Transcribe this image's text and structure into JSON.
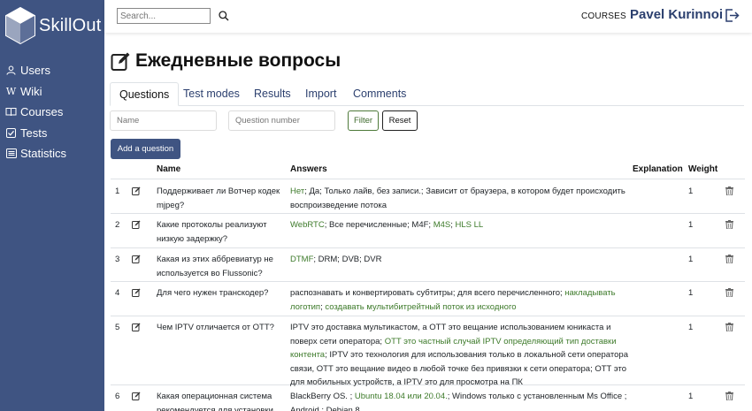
{
  "app": {
    "brand": "SkillOut"
  },
  "sidebar": {
    "items": [
      {
        "label": "Users",
        "icon": "user-icon"
      },
      {
        "label": "Wiki",
        "icon": "wiki-icon"
      },
      {
        "label": "Courses",
        "icon": "book-icon"
      },
      {
        "label": "Tests",
        "icon": "checkbox-icon"
      },
      {
        "label": "Statistics",
        "icon": "list-icon"
      }
    ]
  },
  "header": {
    "search_placeholder": "Search...",
    "courses_label": "COURSES",
    "user_name": "Pavel Kurinnoi"
  },
  "page": {
    "title": "Ежедневные вопросы"
  },
  "tabs": [
    {
      "label": "Questions",
      "active": true
    },
    {
      "label": "Test modes"
    },
    {
      "label": "Results"
    },
    {
      "label": "Import"
    },
    {
      "label": "Comments"
    }
  ],
  "filters": {
    "name_placeholder": "Name",
    "number_placeholder": "Question number",
    "filter_label": "Filter",
    "reset_label": "Reset"
  },
  "add_question_label": "Add a question",
  "table": {
    "headers": {
      "name": "Name",
      "answers": "Answers",
      "explanation": "Explanation",
      "weight": "Weight"
    },
    "rows": [
      {
        "num": "1",
        "name": "Поддерживает ли Вотчер кодек mjpeg?",
        "answers": [
          {
            "text": "Нет",
            "correct": true
          },
          {
            "text": "; Да; Только лайв, без записи.; Зависит от браузера, в котором будет происходить воспроизведение потока",
            "correct": false
          }
        ],
        "weight": "1"
      },
      {
        "num": "2",
        "name": "Какие протоколы реализуют низкую задержку?",
        "answers": [
          {
            "text": "WebRTC",
            "correct": true
          },
          {
            "text": "; Все перечисленные; M4F; ",
            "correct": false
          },
          {
            "text": "M4S",
            "correct": true
          },
          {
            "text": "; ",
            "correct": false
          },
          {
            "text": "HLS LL",
            "correct": true
          }
        ],
        "weight": "1"
      },
      {
        "num": "3",
        "name": "Какая из этих аббревиатур не используется во Flussonic?",
        "answers": [
          {
            "text": "DTMF",
            "correct": true
          },
          {
            "text": "; DRM; DVB; DVR",
            "correct": false
          }
        ],
        "weight": "1"
      },
      {
        "num": "4",
        "name": "Для чего нужен транскодер?",
        "answers": [
          {
            "text": "распознавать и конвертировать субтитры; для всего перечисленного; ",
            "correct": false
          },
          {
            "text": "накладывать логотип",
            "correct": true
          },
          {
            "text": "; ",
            "correct": false
          },
          {
            "text": "создавать мультибитрейтный поток из исходного",
            "correct": true
          }
        ],
        "weight": "1"
      },
      {
        "num": "5",
        "name": "Чем IPTV отличается от OTT?",
        "answers": [
          {
            "text": "IPTV это доставка мультикастом, а OTT это вещание использованием юникаста и поверх сети оператора; ",
            "correct": false
          },
          {
            "text": "OTT это частный случай IPTV определяющий тип доставки контента",
            "correct": true
          },
          {
            "text": "; IPTV это технология для использования только в локальной сети оператора связи, OTT это вещание видео в любой точке без привязки к сети оператора; OTT это для мобильных устройств, а IPTV это для просмотра на ПК",
            "correct": false
          }
        ],
        "weight": "1"
      },
      {
        "num": "6",
        "name": "Какая операционная система рекомендуется для установки",
        "answers": [
          {
            "text": "BlackBerry OS. ; ",
            "correct": false
          },
          {
            "text": "Ubuntu 18.04 или 20.04.",
            "correct": true
          },
          {
            "text": "; Windows только с установленным Ms Office ; Android ; Debian 8",
            "correct": false
          }
        ],
        "weight": "1"
      }
    ]
  }
}
